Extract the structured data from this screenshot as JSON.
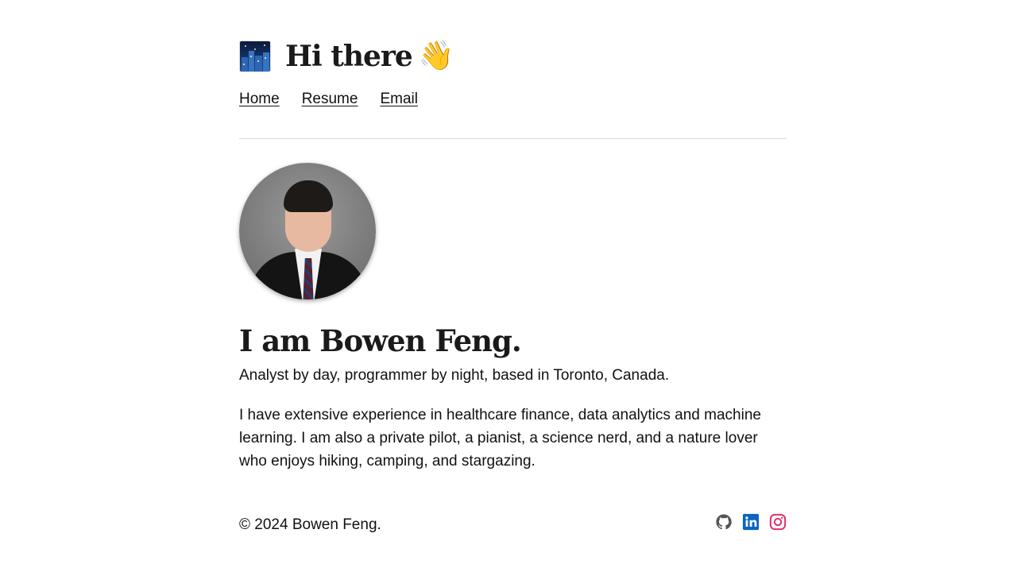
{
  "header": {
    "logo_icon": "city-night-icon",
    "title": "Hi there",
    "title_emoji": "👋"
  },
  "nav": {
    "items": [
      {
        "label": "Home"
      },
      {
        "label": "Resume"
      },
      {
        "label": "Email"
      }
    ]
  },
  "profile": {
    "avatar_icon": "profile-photo",
    "heading": "I am Bowen Feng.",
    "tagline": "Analyst by day, programmer by night, based in Toronto, Canada.",
    "bio": "I have extensive experience in healthcare finance, data analytics and machine learning. I am also a private pilot, a pianist, a science nerd, and a nature lover who enjoys hiking, camping, and stargazing."
  },
  "footer": {
    "copyright": "© 2024 Bowen Feng.",
    "socials": [
      {
        "icon": "github-icon",
        "color": "#555555"
      },
      {
        "icon": "linkedin-icon",
        "color": "#0a66c2"
      },
      {
        "icon": "instagram-icon",
        "color": "#e1306c"
      }
    ]
  }
}
